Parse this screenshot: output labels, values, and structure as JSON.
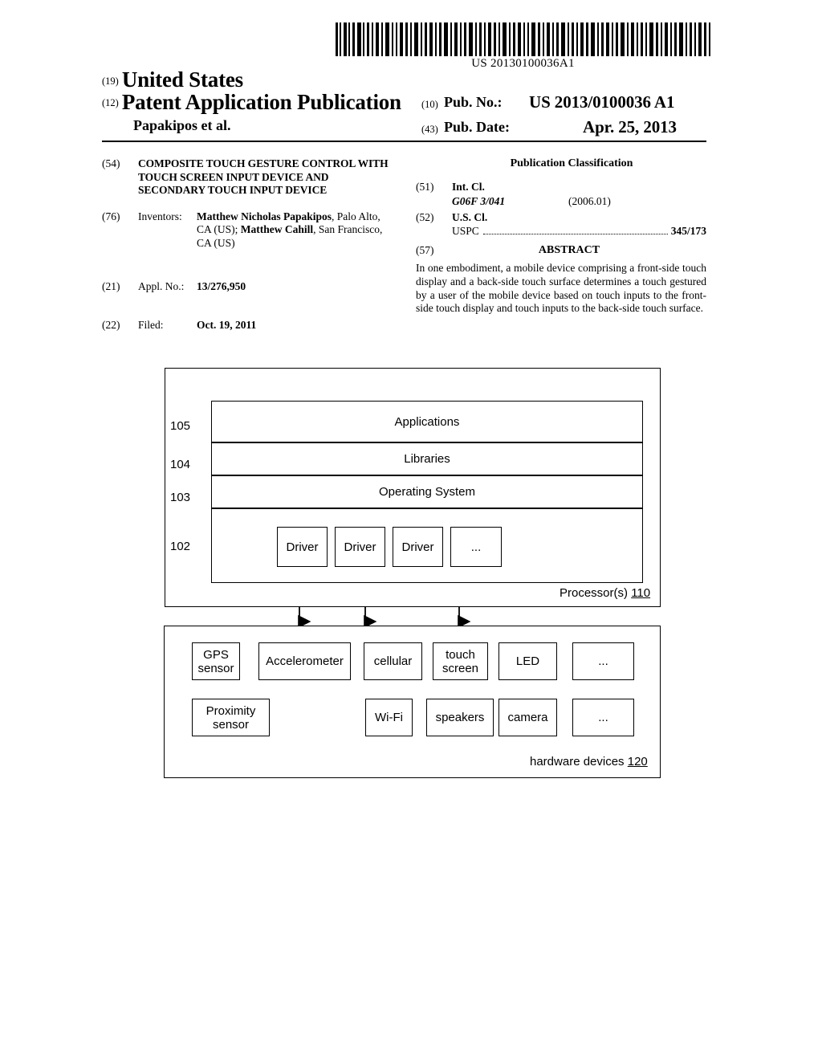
{
  "barcode": {
    "number": "US 20130100036A1"
  },
  "header": {
    "inid_19": "(19)",
    "country": "United States",
    "inid_12": "(12)",
    "doc_type": "Patent Application Publication",
    "applicant_line": "Papakipos et al.",
    "inid_10": "(10)",
    "pubno_label": "Pub. No.:",
    "pubno_value": "US 2013/0100036 A1",
    "inid_43": "(43)",
    "pubdate_label": "Pub. Date:",
    "pubdate_value": "Apr. 25, 2013"
  },
  "left_column": {
    "title": {
      "inid": "(54)",
      "text": "COMPOSITE TOUCH GESTURE CONTROL WITH TOUCH SCREEN INPUT DEVICE AND SECONDARY TOUCH INPUT DEVICE"
    },
    "inventors": {
      "inid": "(76)",
      "key": "Inventors:",
      "name_1": "Matthew Nicholas Papakipos",
      "addr_1": ", Palo Alto, CA (US); ",
      "name_2": "Matthew Cahill",
      "addr_2": ", San Francisco, CA (US)"
    },
    "appl_no": {
      "inid": "(21)",
      "key": "Appl. No.:",
      "value": "13/276,950"
    },
    "filed": {
      "inid": "(22)",
      "key": "Filed:",
      "value": "Oct. 19, 2011"
    }
  },
  "right_column": {
    "pub_class_heading": "Publication Classification",
    "int_cl": {
      "inid": "(51)",
      "label": "Int. Cl.",
      "code": "G06F 3/041",
      "edition": "(2006.01)"
    },
    "us_cl": {
      "inid": "(52)",
      "label": "U.S. Cl.",
      "uspc_key": "USPC",
      "uspc_value": "345/173"
    },
    "abstract": {
      "inid": "(57)",
      "heading": "ABSTRACT",
      "text": "In one embodiment, a mobile device comprising a front-side touch display and a back-side touch surface determines a touch gestured by a user of the mobile device based on touch inputs to the front-side touch display and touch inputs to the back-side touch surface."
    }
  },
  "figure": {
    "ref_105": "105",
    "ref_104": "104",
    "ref_103": "103",
    "ref_102": "102",
    "stack": {
      "applications": "Applications",
      "libraries": "Libraries",
      "operating_system": "Operating System",
      "driver_1": "Driver",
      "driver_2": "Driver",
      "driver_3": "Driver",
      "driver_ellipsis": "..."
    },
    "processor_label_text": "Processor(s) ",
    "processor_refnum": "110",
    "hardware": {
      "gps_sensor": "GPS sensor",
      "accelerometer": "Accelerometer",
      "cellular": "cellular",
      "touch_screen": "touch screen",
      "led": "LED",
      "ellipsis_1": "...",
      "proximity_sensor": "Proximity sensor",
      "wifi": "Wi-Fi",
      "speakers": "speakers",
      "camera": "camera",
      "ellipsis_2": "..."
    },
    "hardware_label_text": "hardware devices ",
    "hardware_refnum": "120"
  }
}
